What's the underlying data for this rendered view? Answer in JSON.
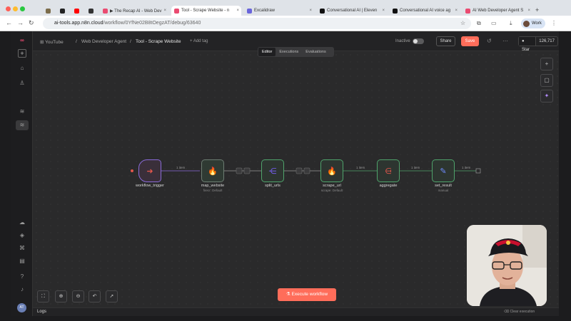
{
  "browser": {
    "tabs": [
      {
        "label": ""
      },
      {
        "label": ""
      },
      {
        "label": ""
      },
      {
        "label": ""
      },
      {
        "label": "▶ The Recap AI - Web Dev"
      },
      {
        "label": "Tool - Scrape Website - n"
      },
      {
        "label": "Excalidraw"
      },
      {
        "label": "Conversational AI | Eleven"
      },
      {
        "label": "Conversational AI voice ag"
      },
      {
        "label": "AI Web Developer Agent S"
      }
    ],
    "new_tab": "+",
    "url_host": "ai-tools.app.n8n.cloud",
    "url_path": "/workflow/0YfNe02B8tOegzAT/debug/63640",
    "profile": "Work"
  },
  "header": {
    "breadcrumb_project": "YouTube",
    "breadcrumb_folder": "Web Developer Agent",
    "breadcrumb_sep": "/",
    "workflow_name": "Tool - Scrape Website",
    "add_tag": "+ Add tag",
    "status": "Inactive",
    "share": "Share",
    "save": "Save",
    "star_label": "Star",
    "star_count": "126,717",
    "modes": [
      "Editor",
      "Executions",
      "Evaluations"
    ],
    "active_mode": "Editor"
  },
  "nodes": [
    {
      "name": "workflow_trigger",
      "sub": "",
      "icon": "trigger-icon",
      "color": "#e2574c"
    },
    {
      "name": "map_website",
      "sub": "firecr: Default",
      "icon": "fire-icon",
      "color": "#ff7a1a"
    },
    {
      "name": "split_urls",
      "sub": "",
      "icon": "split-icon",
      "color": "#7b61ff"
    },
    {
      "name": "scrape_url",
      "sub": "scrape: Default",
      "icon": "fire-icon",
      "color": "#ff7a1a"
    },
    {
      "name": "aggregate",
      "sub": "",
      "icon": "aggregate-icon",
      "color": "#e2574c"
    },
    {
      "name": "set_result",
      "sub": "manual",
      "icon": "pencil-icon",
      "color": "#6f8cff"
    }
  ],
  "edges": [
    "1 item",
    "",
    "",
    "1 item",
    "1 item",
    "1 item"
  ],
  "execute": "Execute workflow",
  "logs": {
    "title": "Logs",
    "clear": "Clear execution"
  }
}
